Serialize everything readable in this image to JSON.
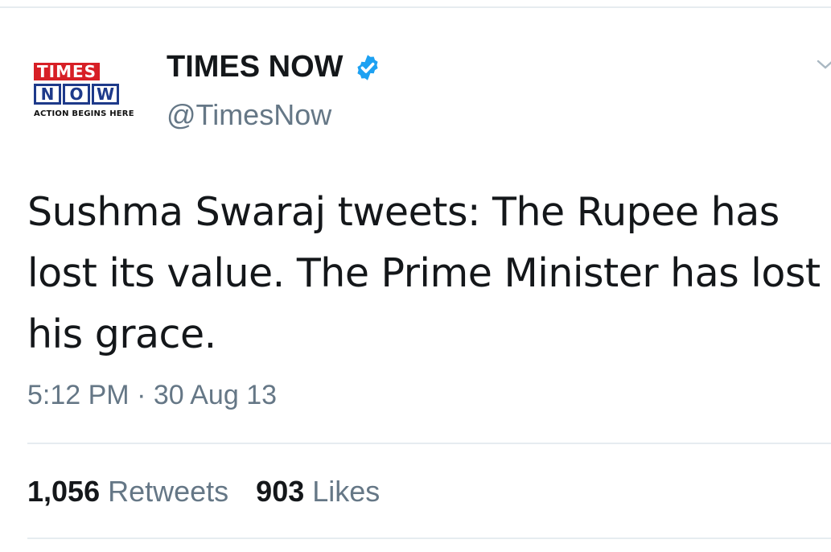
{
  "account": {
    "logo": {
      "word1": "TIMES",
      "word2_letters": [
        "N",
        "O",
        "W"
      ],
      "tagline": "ACTION BEGINS HERE"
    },
    "display_name": "TIMES NOW",
    "handle": "@TimesNow",
    "verified": true
  },
  "tweet": {
    "text": "Sushma Swaraj tweets: The Rupee has lost its value. The Prime Minister has lost his grace.",
    "time": "5:12 PM",
    "separator": "·",
    "date": "30 Aug 13"
  },
  "stats": {
    "retweets_count": "1,056",
    "retweets_label": "Retweets",
    "likes_count": "903",
    "likes_label": "Likes"
  },
  "colors": {
    "brand_red": "#d71f26",
    "brand_navy": "#1e3a8a",
    "verified_blue": "#1da1f2",
    "text_primary": "#14171a",
    "text_secondary": "#657786",
    "divider": "#e6ecf0"
  },
  "icons": {
    "verified": "verified-badge-icon",
    "menu": "chevron-down-icon"
  }
}
